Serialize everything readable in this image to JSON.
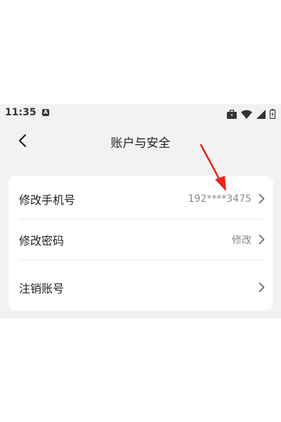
{
  "status_bar": {
    "time": "11:35",
    "notification_icon": "a-letter-icon",
    "right_icons": [
      "briefcase-icon",
      "wifi-icon",
      "signal-icon",
      "battery-icon"
    ]
  },
  "header": {
    "title": "账户与安全",
    "back_icon": "chevron-left-icon"
  },
  "settings": {
    "items": [
      {
        "label": "修改手机号",
        "value": "192****3475"
      },
      {
        "label": "修改密码",
        "value": "修改"
      },
      {
        "label": "注销账号",
        "value": ""
      }
    ]
  },
  "colors": {
    "background": "#f2f2f2",
    "card": "#ffffff",
    "secondary_text": "#8a8a8a",
    "annotation_arrow": "#e8231b"
  }
}
